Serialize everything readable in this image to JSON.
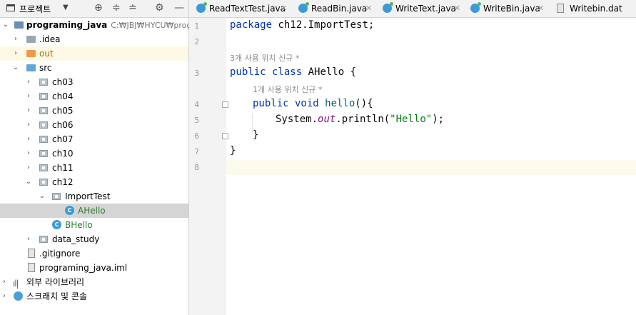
{
  "project_panel": {
    "title": "프로젝트",
    "tree": [
      {
        "label": "programing_java",
        "path": "C:₩JBJ₩HYCU₩programing_java"
      },
      {
        "label": ".idea"
      },
      {
        "label": "out"
      },
      {
        "label": "src"
      },
      {
        "label": "ch03"
      },
      {
        "label": "ch04"
      },
      {
        "label": "ch05"
      },
      {
        "label": "ch06"
      },
      {
        "label": "ch07"
      },
      {
        "label": "ch10"
      },
      {
        "label": "ch11"
      },
      {
        "label": "ch12"
      },
      {
        "label": "ImportTest"
      },
      {
        "label": "AHello"
      },
      {
        "label": "BHello"
      },
      {
        "label": "data_study"
      },
      {
        "label": ".gitignore"
      },
      {
        "label": "programing_java.iml"
      },
      {
        "label": "외부 라이브러리"
      },
      {
        "label": "스크래치 및 콘솔"
      }
    ]
  },
  "tabs": [
    {
      "label": "ReadTextTest.java"
    },
    {
      "label": "ReadBin.java"
    },
    {
      "label": "WriteText.java"
    },
    {
      "label": "WriteBin.java"
    },
    {
      "label": "Writebin.dat"
    }
  ],
  "editor": {
    "line_numbers": [
      "1",
      "2",
      "3",
      "4",
      "5",
      "6",
      "7",
      "8"
    ],
    "hints": [
      "3개 사용 위치   신규 *",
      "1개 사용 위치   신규 *"
    ],
    "code": {
      "l1_kw": "package",
      "l1_rest": " ch12.ImportTest;",
      "l3_kw": "public class",
      "l3_rest": " AHello {",
      "l4_kw": "public void",
      "l4_fn": " hello",
      "l4_rest": "(){",
      "l5_a": "System.",
      "l5_b": "out",
      "l5_c": ".println(",
      "l5_str": "\"Hello\"",
      "l5_d": ");",
      "l6": "}",
      "l7": "}"
    }
  },
  "colors": {
    "keyword": "#0033b3",
    "string": "#067d17",
    "field": "#871094",
    "selected_row": "#d5d5d5"
  }
}
